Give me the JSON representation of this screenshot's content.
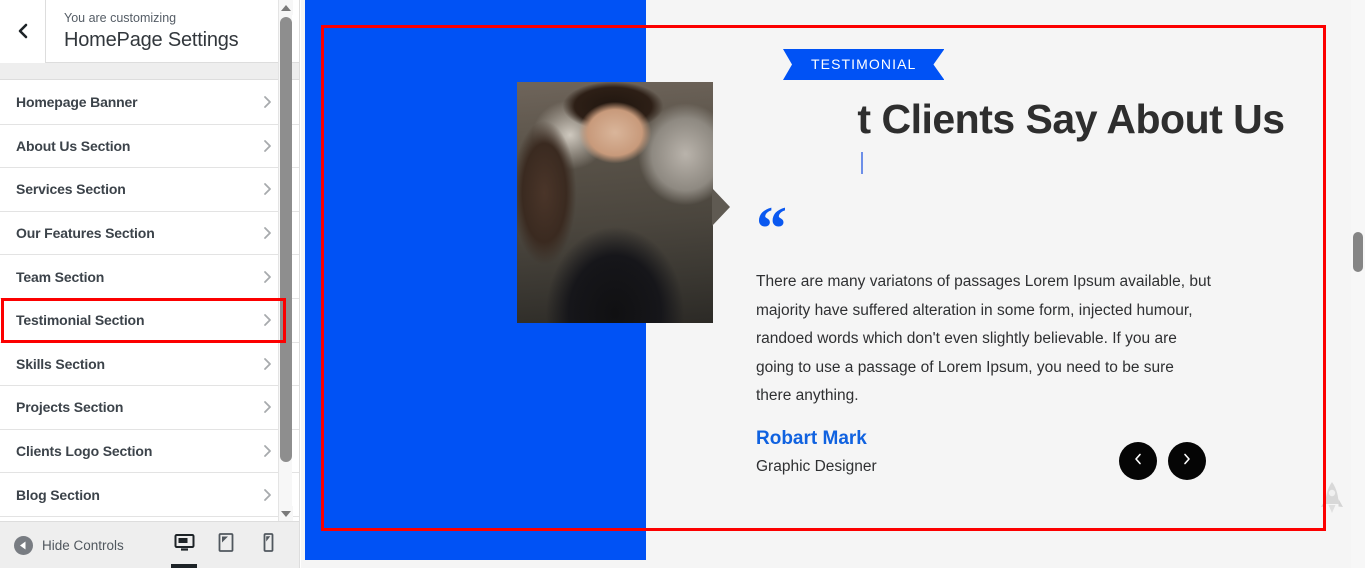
{
  "sidebar": {
    "back_icon": "chevron-left-icon",
    "kicker": "You are customizing",
    "title": "HomePage Settings",
    "items": [
      {
        "label": "Homepage Banner",
        "chevron": "chevron-right-icon"
      },
      {
        "label": "About Us Section",
        "chevron": "chevron-right-icon"
      },
      {
        "label": "Services Section",
        "chevron": "chevron-right-icon"
      },
      {
        "label": "Our Features Section",
        "chevron": "chevron-right-icon"
      },
      {
        "label": "Team Section",
        "chevron": "chevron-right-icon"
      },
      {
        "label": "Testimonial Section",
        "chevron": "chevron-right-icon"
      },
      {
        "label": "Skills Section",
        "chevron": "chevron-right-icon"
      },
      {
        "label": "Projects Section",
        "chevron": "chevron-right-icon"
      },
      {
        "label": "Clients Logo Section",
        "chevron": "chevron-right-icon"
      },
      {
        "label": "Blog Section",
        "chevron": "chevron-right-icon"
      }
    ],
    "footer": {
      "hide_controls_label": "Hide Controls",
      "hide_controls_icon": "collapse-arrow-icon",
      "devices": [
        {
          "name": "desktop-preview",
          "icon": "desktop-icon",
          "active": true
        },
        {
          "name": "tablet-preview",
          "icon": "tablet-icon",
          "active": false
        },
        {
          "name": "mobile-preview",
          "icon": "mobile-icon",
          "active": false
        }
      ]
    },
    "scrollbar": {
      "up_icon": "scroll-up-arrow-icon",
      "down_icon": "scroll-down-arrow-icon"
    }
  },
  "preview": {
    "badge": "TESTIMONIAL",
    "heading": "t Clients Say About Us",
    "quote_icon": "quote-open-icon",
    "quote_text": "There are many variatons of passages Lorem Ipsum available, but majority have suffered alteration in some form, injected humour, randoed words which don't even slightly believable. If you are going to use a passage of Lorem Ipsum, you need to be sure there anything.",
    "author_name": "Robart Mark",
    "author_role": "Graphic Designer",
    "photo_alt": "testimonial-portrait",
    "nav": {
      "prev_icon": "chevron-left-icon",
      "next_icon": "chevron-right-icon"
    },
    "scroll_top_icon": "rocket-icon"
  },
  "colors": {
    "brand_blue": "#0052f5",
    "accent_blue": "#1062e0",
    "annotation_red": "#fc0000",
    "nav_black": "#050505",
    "preview_bg": "#f5f5f5"
  }
}
